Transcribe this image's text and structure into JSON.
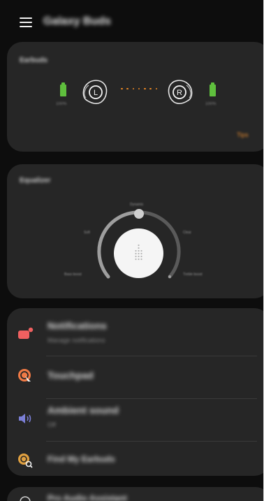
{
  "app": {
    "title": "Galaxy Buds"
  },
  "earbuds": {
    "section_label": "Earbuds",
    "left": {
      "label": "L",
      "battery_text": "100%"
    },
    "right": {
      "label": "R",
      "battery_text": "100%"
    },
    "tips_label": "Tips"
  },
  "equalizer": {
    "section_label": "Equalizer",
    "preset_top": "Dynamic",
    "preset_left_upper": "Soft",
    "preset_right_upper": "Clear",
    "preset_left_lower": "Bass boost",
    "preset_right_lower": "Treble boost"
  },
  "list": {
    "items": [
      {
        "title": "Notifications",
        "subtitle": "Manage notifications",
        "icon": "notifications-icon"
      },
      {
        "title": "Touchpad",
        "subtitle": "",
        "icon": "touchpad-icon"
      },
      {
        "title": "Ambient sound",
        "subtitle": "Off",
        "icon": "ambient-sound-icon"
      },
      {
        "title": "Find My Earbuds",
        "subtitle": "",
        "icon": "find-earbuds-icon"
      }
    ]
  },
  "bottom": {
    "title": "Pro Audio Assistant"
  },
  "colors": {
    "background": "#0d0d0d",
    "card": "#262626",
    "accent_orange": "#f08a24",
    "battery_green": "#5fbf3d",
    "notifications_icon": "#f06060",
    "touchpad_icon": "#f07a45",
    "ambient_icon": "#7b7fd6",
    "find_icon": "#e0a040"
  }
}
